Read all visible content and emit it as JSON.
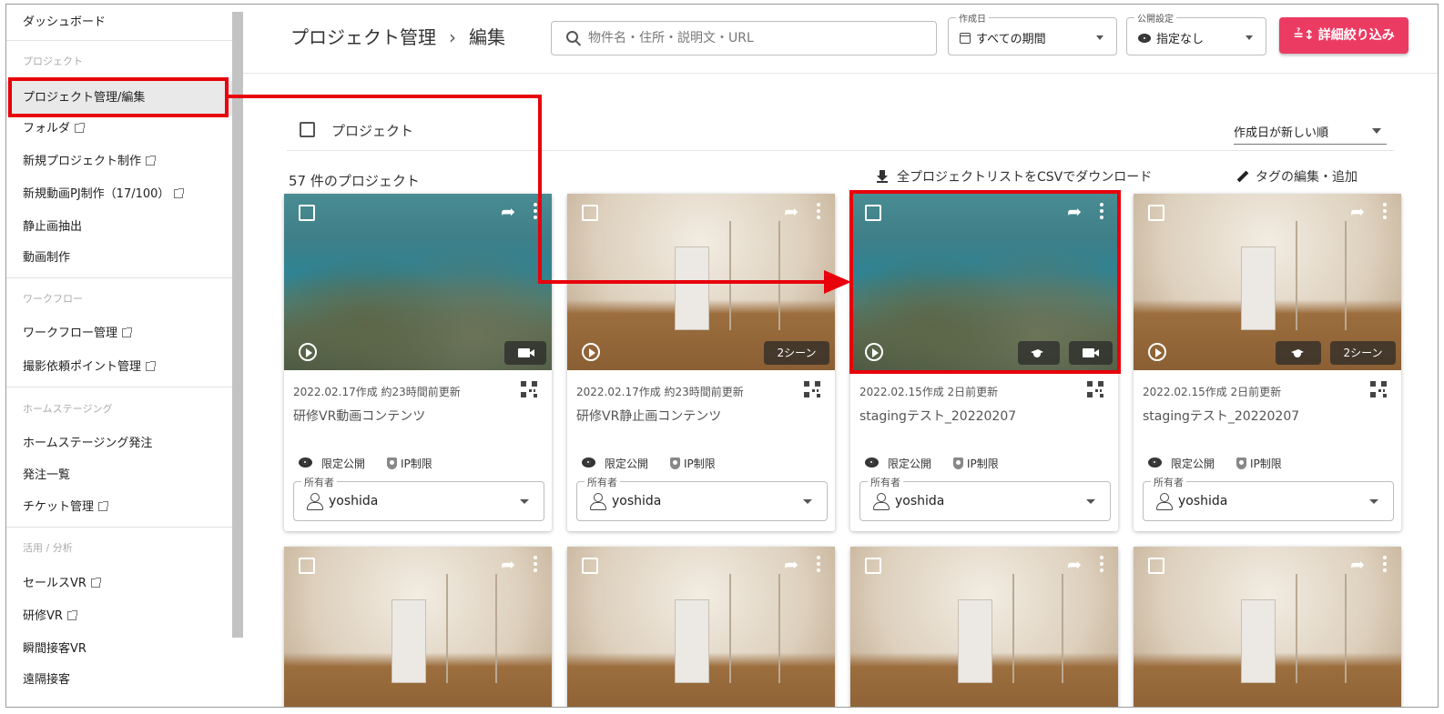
{
  "sidebar": {
    "dashboard": "ダッシュボード",
    "sec_project": "プロジェクト",
    "project_manage": "プロジェクト管理/編集",
    "folder": "フォルダ",
    "new_project": "新規プロジェクト制作",
    "new_video": "新規動画PJ制作（17/100）",
    "still_extract": "静止画抽出",
    "video_make": "動画制作",
    "sec_workflow": "ワークフロー",
    "workflow_manage": "ワークフロー管理",
    "shoot_point": "撮影依頼ポイント管理",
    "sec_staging": "ホームステージング",
    "staging_order": "ホームステージング発注",
    "order_list": "発注一覧",
    "ticket": "チケット管理",
    "sec_analysis": "活用 / 分析",
    "sales_vr": "セールスVR",
    "training_vr": "研修VR",
    "instant_vr": "瞬間接客VR",
    "remote": "遠隔接客"
  },
  "header": {
    "title": "プロジェクト管理",
    "separator": "›",
    "subtitle": "編集",
    "search_placeholder": "物件名・住所・説明文・URL",
    "created_label": "作成日",
    "created_value": "すべての期間",
    "public_label": "公開設定",
    "public_value": "指定なし",
    "filter_icon": "≟↕",
    "filter_button": "詳細絞り込み"
  },
  "main": {
    "select_all_label": "プロジェクト",
    "sort_value": "作成日が新しい順",
    "count": "57 件のプロジェクト",
    "csv_download": "全プロジェクトリストをCSVでダウンロード",
    "tag_edit": "タグの編集・追加"
  },
  "cards": [
    {
      "meta": "2022.02.17作成 約23時間前更新",
      "title": "研修VR動画コンテンツ",
      "visibility": "限定公開",
      "ip": "IP制限",
      "owner_label": "所有者",
      "owner": "yoshida",
      "badges": [
        "video-icon"
      ]
    },
    {
      "meta": "2022.02.17作成 約23時間前更新",
      "title": "研修VR静止画コンテンツ",
      "visibility": "限定公開",
      "ip": "IP制限",
      "owner_label": "所有者",
      "owner": "yoshida",
      "scenes": "2シーン"
    },
    {
      "meta": "2022.02.15作成 2日前更新",
      "title": "stagingテスト_20220207",
      "visibility": "限定公開",
      "ip": "IP制限",
      "owner_label": "所有者",
      "owner": "yoshida",
      "badges": [
        "graduation-cap-icon",
        "video-icon"
      ]
    },
    {
      "meta": "2022.02.15作成 2日前更新",
      "title": "stagingテスト_20220207",
      "visibility": "限定公開",
      "ip": "IP制限",
      "owner_label": "所有者",
      "owner": "yoshida",
      "scenes": "2シーン",
      "badges": [
        "graduation-cap-icon"
      ]
    }
  ],
  "icons": {
    "share": "share-icon",
    "more": "more-vert-icon",
    "play": "play-circle-icon",
    "qr": "qr-code-icon",
    "external": "external-link-icon"
  },
  "colors": {
    "accent": "#ec3b63",
    "annotation": "#e8000b",
    "sidebar_active": "#e9e9e9"
  }
}
